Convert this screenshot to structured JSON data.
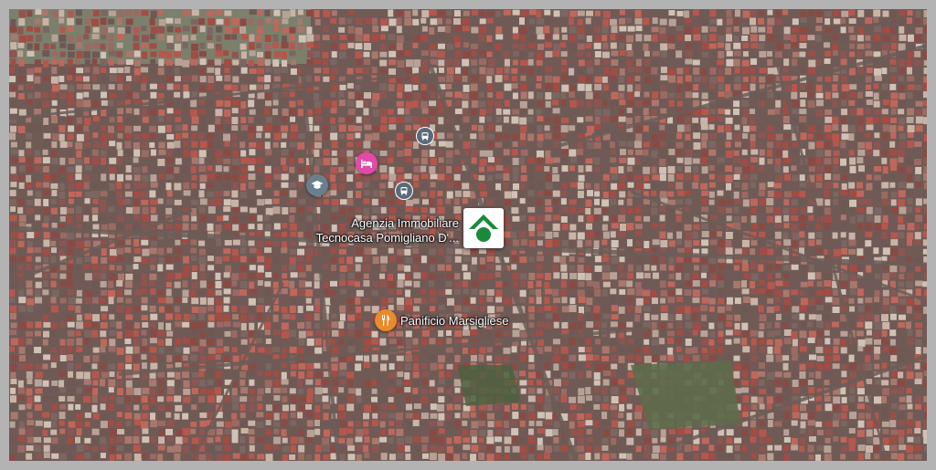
{
  "map": {
    "type": "satellite",
    "places": [
      {
        "id": "agency",
        "name": "Agenzia Immobiliare Tecnocasa Pomigliano D'...",
        "line1": "Agenzia Immobiliare",
        "line2": "Tecnocasa Pomigliano D'...",
        "icon": "tecnocasa-house-logo-icon",
        "color": "#1a8a3a"
      },
      {
        "id": "bakery",
        "name": "Panificio Marsigliese",
        "icon": "restaurant-icon",
        "color": "#ea8a2b"
      },
      {
        "id": "hotel",
        "icon": "hotel-bed-icon",
        "color": "#e24aa8"
      },
      {
        "id": "school",
        "icon": "graduation-cap-icon",
        "color": "#6a7f8e"
      },
      {
        "id": "bus1",
        "icon": "bus-stop-icon",
        "color": "#5a6b7a"
      },
      {
        "id": "bus2",
        "icon": "bus-stop-icon",
        "color": "#5a6b7a"
      }
    ]
  }
}
